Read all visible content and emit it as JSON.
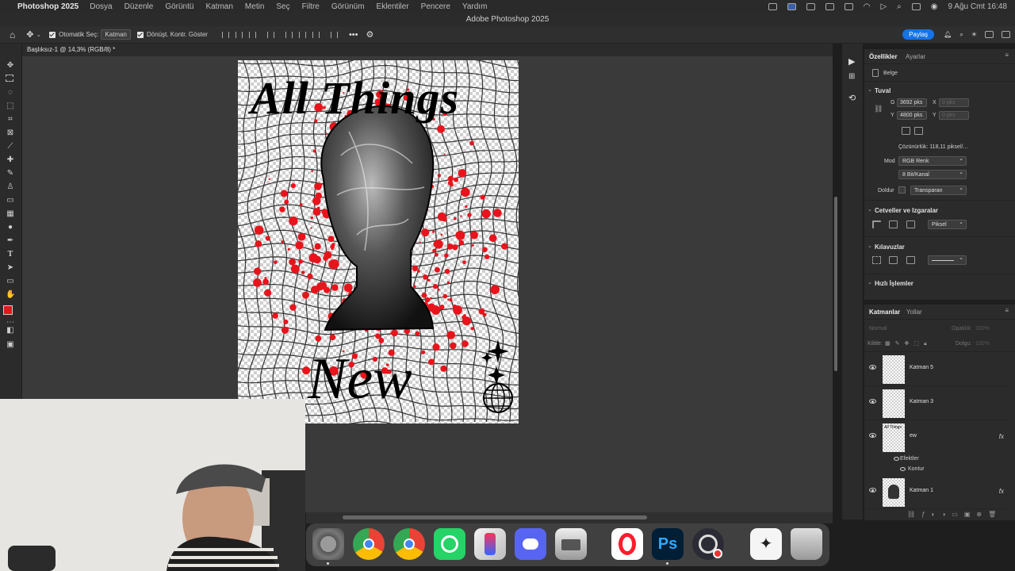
{
  "menubar": {
    "app": "Photoshop 2025",
    "items": [
      "Dosya",
      "Düzenle",
      "Görüntü",
      "Katman",
      "Metin",
      "Seç",
      "Filtre",
      "Görünüm",
      "Eklentiler",
      "Pencere",
      "Yardım"
    ],
    "clock": "9 Ağu Cmt  16:48"
  },
  "titlebar": {
    "title": "Adobe Photoshop 2025"
  },
  "options": {
    "auto_select_label": "Otomatik Seç:",
    "auto_select_value": "Katman",
    "transform_label": "Dönüşt. Kontr. Göster",
    "share_label": "Paylaş"
  },
  "doc_tab": {
    "label": "Başlıksız-1 @ 14,3% (RGB/8) *"
  },
  "artwork": {
    "line1": "All Things",
    "line2": "New"
  },
  "properties": {
    "tabs": [
      "Özellikler",
      "Ayarlar"
    ],
    "doc_label": "Belge",
    "canvas_section": "Tuval",
    "width_label": "G",
    "width_value": "3692 pks",
    "height_label": "Y",
    "height_value": "4800 pks",
    "x_label": "X",
    "x_value": "0 pks",
    "y_label": "Y",
    "y_value": "0 pks",
    "resolution": "Çözünürlük: 118,11 piksel/...",
    "mode_label": "Mod",
    "mode_value": "RGB Renk",
    "bit_value": "8 Bit/Kanal",
    "fill_label": "Doldur",
    "fill_value": "Transparan",
    "rulers_section": "Cetveller ve Izgaralar",
    "unit_value": "Piksel",
    "guides_section": "Kılavuzlar",
    "quick_section": "Hızlı İşlemler"
  },
  "layers": {
    "tabs": [
      "Katmanlar",
      "Yollar"
    ],
    "blend_mode": "Normal",
    "opacity_label": "Opaklık:",
    "opacity_value": "100%",
    "lock_label": "Kilitle:",
    "fill_label": "Dolgu:",
    "fill_value": "100%",
    "items": [
      {
        "name": "Katman 5",
        "fx": ""
      },
      {
        "name": "Katman 3",
        "fx": ""
      },
      {
        "name": "ew",
        "fx": "fx"
      },
      {
        "name": "Katman 1",
        "fx": "fx"
      }
    ],
    "effects_label": "Efektler",
    "stroke_label": "Kontur"
  },
  "colors": {
    "foreground": "#e8141c",
    "background": "#2e2ad6",
    "accent": "#1473e6"
  }
}
